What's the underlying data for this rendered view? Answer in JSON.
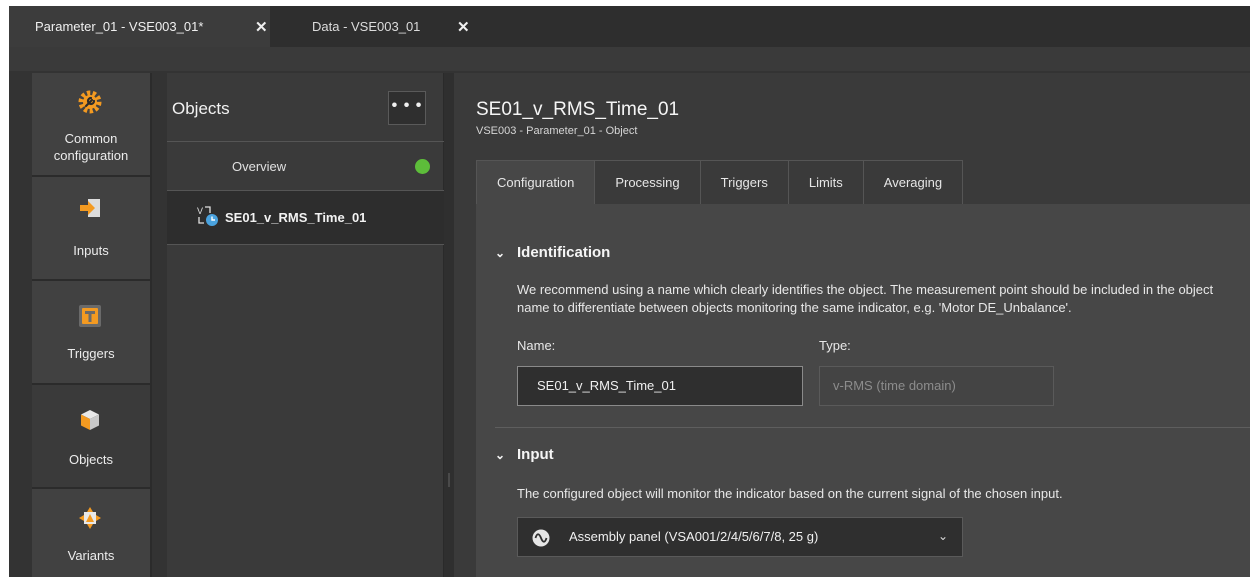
{
  "tabs": [
    {
      "label": "Parameter_01 - VSE003_01*",
      "close": "✕"
    },
    {
      "label": "Data - VSE003_01",
      "close": "✕"
    }
  ],
  "nav": {
    "items": [
      {
        "label_line1": "Common",
        "label_line2": "configuration",
        "icon": "gear-wrench-icon"
      },
      {
        "label": "Inputs",
        "icon": "input-arrow-icon"
      },
      {
        "label": "Triggers",
        "icon": "trigger-t-icon"
      },
      {
        "label": "Objects",
        "icon": "cube-icon"
      },
      {
        "label": "Variants",
        "icon": "variants-icon"
      }
    ],
    "active": "Objects"
  },
  "objects_panel": {
    "title": "Objects",
    "more_label": "• • •",
    "overview_label": "Overview",
    "overview_status_color": "#5dbd3a",
    "object_item": "SE01_v_RMS_Time_01"
  },
  "main": {
    "title": "SE01_v_RMS_Time_01",
    "subtitle": "VSE003 - Parameter_01 - Object",
    "tabs": [
      "Configuration",
      "Processing",
      "Triggers",
      "Limits",
      "Averaging"
    ],
    "active_tab": "Configuration",
    "identification": {
      "heading": "Identification",
      "chevron": "⌄",
      "description": "We recommend using a name which clearly identifies the object. The measurement point should be included in the object name to differentiate between objects monitoring the same indicator, e.g. 'Motor DE_Unbalance'.",
      "name_label": "Name:",
      "name_value": "SE01_v_RMS_Time_01",
      "type_label": "Type:",
      "type_placeholder": "v-RMS (time domain)"
    },
    "input": {
      "heading": "Input",
      "chevron": "⌄",
      "description": "The configured object will monitor the indicator based on the current signal of the chosen input.",
      "selected": "Assembly panel (VSA001/2/4/5/6/7/8, 25 g)",
      "caret": "⌄"
    }
  },
  "colors": {
    "accent_orange": "#f39a21",
    "status_green": "#5dbd3a"
  }
}
